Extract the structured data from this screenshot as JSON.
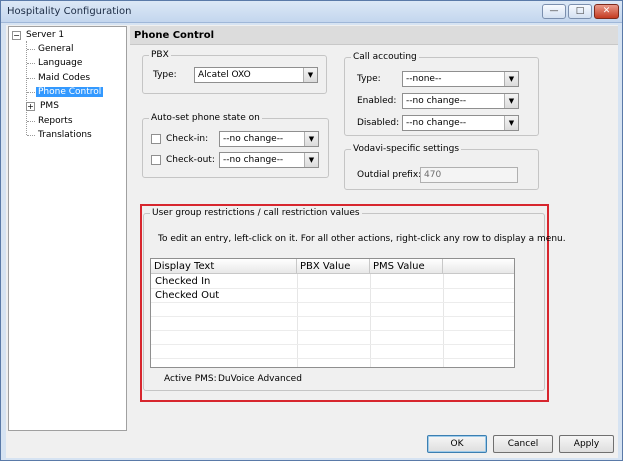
{
  "window": {
    "title": "Hospitality Configuration",
    "controls": {
      "minimize": "—",
      "maximize": "□",
      "close": "✕"
    }
  },
  "tree": {
    "root": {
      "label": "Server 1",
      "expander": "−"
    },
    "items": [
      {
        "label": "General"
      },
      {
        "label": "Language"
      },
      {
        "label": "Maid Codes"
      },
      {
        "label": "Phone Control",
        "selected": true
      },
      {
        "label": "PMS",
        "expander": "+"
      },
      {
        "label": "Reports"
      },
      {
        "label": "Translations"
      }
    ]
  },
  "main": {
    "header": "Phone Control",
    "pbx": {
      "legend": "PBX",
      "type_label": "Type:",
      "type_value": "Alcatel OXO"
    },
    "auto_set": {
      "legend": "Auto-set phone state on",
      "checkin_label": "Check-in:",
      "checkin_value": "--no change--",
      "checkout_label": "Check-out:",
      "checkout_value": "--no change--"
    },
    "call_accounting": {
      "legend": "Call accouting",
      "type_label": "Type:",
      "type_value": "--none--",
      "enabled_label": "Enabled:",
      "enabled_value": "--no change--",
      "disabled_label": "Disabled:",
      "disabled_value": "--no change--"
    },
    "vodavi": {
      "legend": "Vodavi-specific settings",
      "prefix_label": "Outdial prefix:",
      "prefix_value": "470"
    },
    "restrictions": {
      "legend": "User group restrictions / call restriction values",
      "instructions": "To edit an entry, left-click on it.  For all other actions, right-click any row to display a menu.",
      "columns": [
        "Display Text",
        "PBX Value",
        "PMS Value"
      ],
      "rows": [
        {
          "display": "Checked In",
          "pbx": "",
          "pms": ""
        },
        {
          "display": "Checked Out",
          "pbx": "",
          "pms": ""
        }
      ],
      "active_pms_label": "Active PMS:",
      "active_pms_value": "DuVoice Advanced"
    }
  },
  "buttons": {
    "ok": "OK",
    "cancel": "Cancel",
    "apply": "Apply"
  },
  "colors": {
    "highlight": "#d7262e",
    "selection": "#3399ff"
  }
}
